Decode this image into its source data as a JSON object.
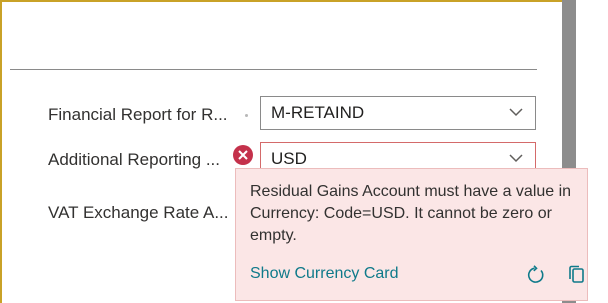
{
  "fields": [
    {
      "label": "Financial Report for R...",
      "value": "M-RETAIND"
    },
    {
      "label": "Additional Reporting ...",
      "value": "USD"
    },
    {
      "label": "VAT Exchange Rate A..."
    }
  ],
  "error_tooltip": {
    "message": "Residual Gains Account must have a value in Currency: Code=USD. It cannot be zero or empty.",
    "action_link": "Show Currency Card"
  },
  "icons": [
    "chevron-down-icon",
    "error-icon",
    "refresh-icon",
    "copy-icon"
  ],
  "colors": {
    "error": "#c4314b",
    "tooltip_bg": "#fbe6e6",
    "link": "#0f7a8a",
    "accent_border": "#c9a227"
  }
}
